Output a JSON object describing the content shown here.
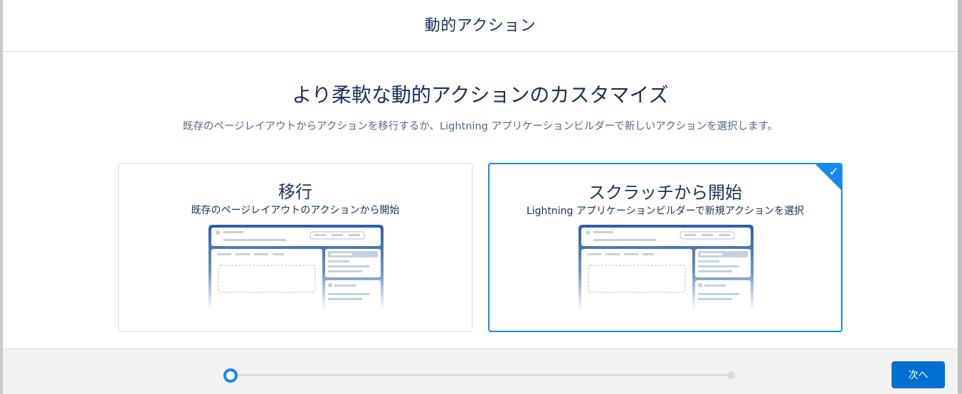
{
  "modal": {
    "title": "動的アクション",
    "headline": "より柔軟な動的アクションのカスタマイズ",
    "subtitle": "既存のページレイアウトからアクションを移行するか、Lightning アプリケーションビルダーで新しいアクションを選択します。"
  },
  "options": [
    {
      "title": "移行",
      "description": "既存のページレイアウトのアクションから開始",
      "selected": false
    },
    {
      "title": "スクラッチから開始",
      "description": "Lightning アプリケーションビルダーで新規アクションを選択",
      "selected": true
    }
  ],
  "footer": {
    "next_label": "次へ",
    "progress": {
      "current_step": 1,
      "total_steps": 2
    }
  },
  "icons": {
    "check": "checkmark-icon",
    "illustration": "page-layout-illustration"
  },
  "colors": {
    "brand": "#0070d2",
    "selected_border": "#1589ee",
    "text_primary": "#16325c",
    "text_secondary": "#54698d",
    "illustration": "#2a5ea5"
  }
}
